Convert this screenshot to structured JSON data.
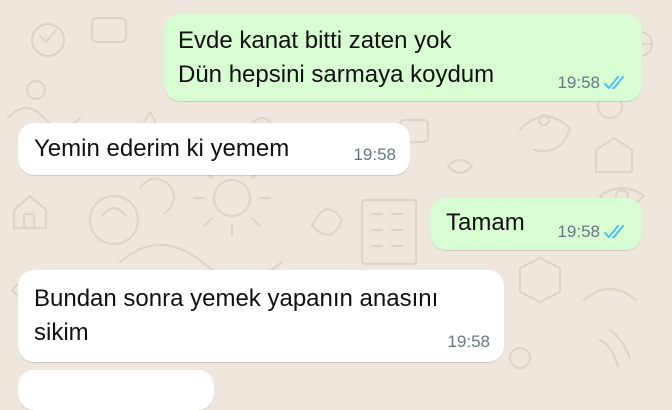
{
  "theme": {
    "outgoing_bg": "#d9fdd3",
    "incoming_bg": "#ffffff",
    "wallpaper_bg": "#efe7dd",
    "read_tick_color": "#53bdeb",
    "meta_color": "#667781"
  },
  "messages": [
    {
      "direction": "outgoing",
      "lines": [
        "Evde kanat bitti zaten yok",
        "Dün hepsini sarmaya koydum"
      ],
      "time": "19:58",
      "status": "read"
    },
    {
      "direction": "incoming",
      "lines": [
        "Yemin ederim ki yemem"
      ],
      "time": "19:58"
    },
    {
      "direction": "outgoing",
      "lines": [
        "Tamam"
      ],
      "time": "19:58",
      "status": "read"
    },
    {
      "direction": "incoming",
      "lines": [
        "Bundan sonra yemek yapanın anasını",
        "sikim"
      ],
      "time": "19:58"
    }
  ]
}
